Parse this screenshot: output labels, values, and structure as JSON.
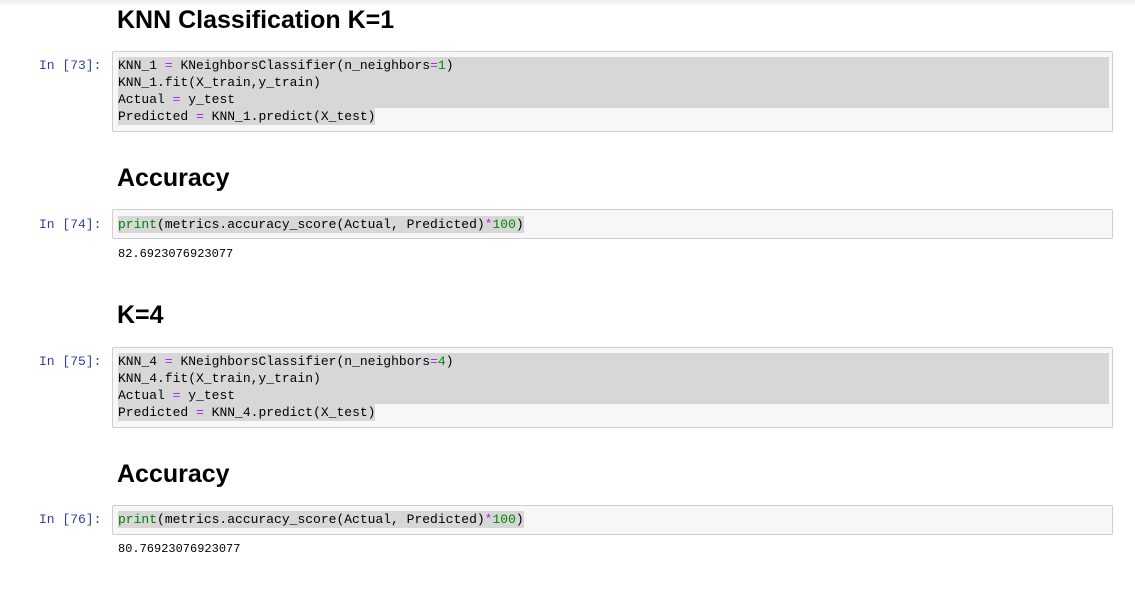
{
  "headings": {
    "knn_k1": "KNN Classification K=1",
    "accuracy_1": "Accuracy",
    "k4": "K=4",
    "accuracy_2": "Accuracy"
  },
  "cells": [
    {
      "prompt": "In [73]:",
      "lines": [
        [
          "KNN_1",
          " ",
          "=",
          " ",
          "KNeighborsClassifier(n_neighbors",
          "=",
          "1",
          ")"
        ],
        [
          "KNN_1.fit(X_train,y_train)"
        ],
        [
          "Actual",
          " ",
          "=",
          " ",
          "y_test"
        ],
        [
          "Predicted",
          " ",
          "=",
          " ",
          "KNN_1.predict(X_test)"
        ]
      ]
    },
    {
      "prompt": "In [74]:",
      "lines": [
        [
          "print",
          "(metrics.accuracy_score(Actual, Predicted)",
          "*",
          "100",
          ")"
        ]
      ],
      "output": "82.6923076923077"
    },
    {
      "prompt": "In [75]:",
      "lines": [
        [
          "KNN_4",
          " ",
          "=",
          " ",
          "KNeighborsClassifier(n_neighbors",
          "=",
          "4",
          ")"
        ],
        [
          "KNN_4.fit(X_train,y_train)"
        ],
        [
          "Actual",
          " ",
          "=",
          " ",
          "y_test"
        ],
        [
          "Predicted",
          " ",
          "=",
          " ",
          "KNN_4.predict(X_test)"
        ]
      ]
    },
    {
      "prompt": "In [76]:",
      "lines": [
        [
          "print",
          "(metrics.accuracy_score(Actual, Predicted)",
          "*",
          "100",
          ")"
        ]
      ],
      "output": "80.76923076923077"
    }
  ],
  "colors": {
    "prompt": "#303f9f",
    "operator": "#aa22ff",
    "number": "#008800",
    "builtin": "#008000",
    "selection": "#d7d7d7",
    "cell_background": "#f7f7f7",
    "cell_border": "#cfcfcf"
  }
}
